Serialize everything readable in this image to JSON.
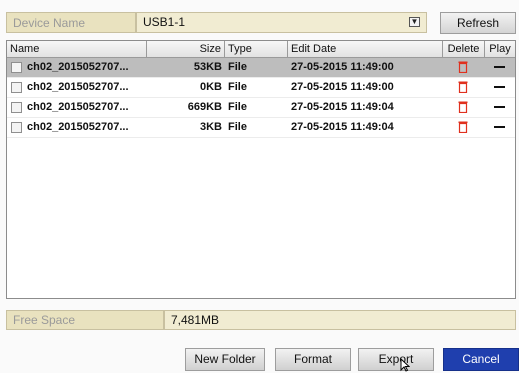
{
  "device": {
    "label": "Device Name",
    "selected": "USB1-1",
    "refresh_label": "Refresh"
  },
  "table": {
    "headers": {
      "name": "Name",
      "size": "Size",
      "type": "Type",
      "edit_date": "Edit Date",
      "delete": "Delete",
      "play": "Play"
    },
    "rows": [
      {
        "name": "ch02_2015052707...",
        "size": "53KB",
        "type": "File",
        "edit_date": "27-05-2015 11:49:00",
        "selected": true
      },
      {
        "name": "ch02_2015052707...",
        "size": "0KB",
        "type": "File",
        "edit_date": "27-05-2015 11:49:00",
        "selected": false
      },
      {
        "name": "ch02_2015052707...",
        "size": "669KB",
        "type": "File",
        "edit_date": "27-05-2015 11:49:04",
        "selected": false
      },
      {
        "name": "ch02_2015052707...",
        "size": "3KB",
        "type": "File",
        "edit_date": "27-05-2015 11:49:04",
        "selected": false
      }
    ]
  },
  "free_space": {
    "label": "Free Space",
    "value": "7,481MB"
  },
  "buttons": {
    "new_folder": "New Folder",
    "format": "Format",
    "export": "Export",
    "cancel": "Cancel"
  },
  "icons": {
    "file": "file-icon",
    "delete": "trash-icon",
    "play": "play-dash-icon",
    "dropdown": "chevron-down-icon"
  },
  "colors": {
    "label_bg": "#e9e2bf",
    "field_bg": "#f1ecd2",
    "selected_row": "#bdbdbd",
    "delete_icon": "#e0301e",
    "cancel_bg": "#1f3fae"
  }
}
